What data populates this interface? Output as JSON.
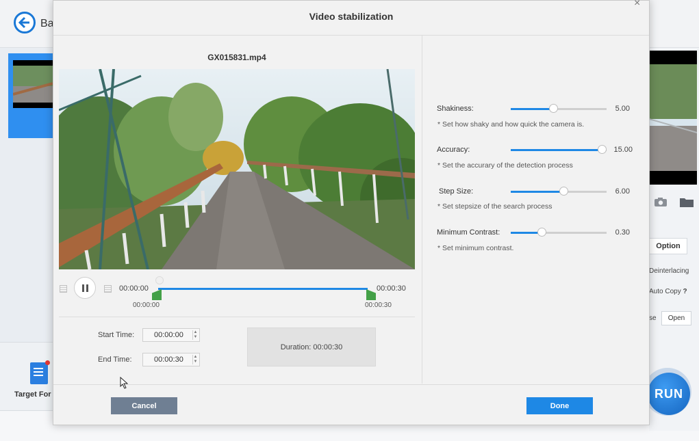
{
  "background_app": {
    "back_label": "Ba",
    "target_format_label": "Target For",
    "option_label": "Option",
    "deinterlacing_label": "Deinterlacing",
    "auto_copy_label": "Auto Copy",
    "auto_copy_help": "?",
    "browse_partial": "se",
    "open_label": "Open",
    "run_label": "RUN"
  },
  "dialog": {
    "title": "Video stabilization",
    "close_glyph": "×",
    "file_name": "GX015831.mp4",
    "timeline": {
      "start_time": "00:00:00",
      "end_time": "00:00:30",
      "range_start": "00:00:00",
      "range_end": "00:00:30"
    },
    "start_time_label": "Start Time:",
    "start_time_value": "00:00:00",
    "end_time_label": "End Time:",
    "end_time_value": "00:00:30",
    "duration_text": "Duration:  00:00:30",
    "params": [
      {
        "label": "Shakiness:",
        "value": "5.00",
        "help": "* Set how shaky and how quick the camera is.",
        "fraction": 0.44
      },
      {
        "label": "Accuracy:",
        "value": "15.00",
        "help": "* Set the accurary of the detection process",
        "fraction": 0.95
      },
      {
        "label": "Step Size:",
        "value": "6.00",
        "help": "* Set stepsize of the search process",
        "fraction": 0.55
      },
      {
        "label": "Minimum Contrast:",
        "value": "0.30",
        "help": "* Set minimum contrast.",
        "fraction": 0.32
      }
    ],
    "cancel_label": "Cancel",
    "done_label": "Done"
  },
  "colors": {
    "accent": "#1e88e5",
    "trim_marker": "#43a047",
    "cancel_button": "#6f7f93"
  }
}
